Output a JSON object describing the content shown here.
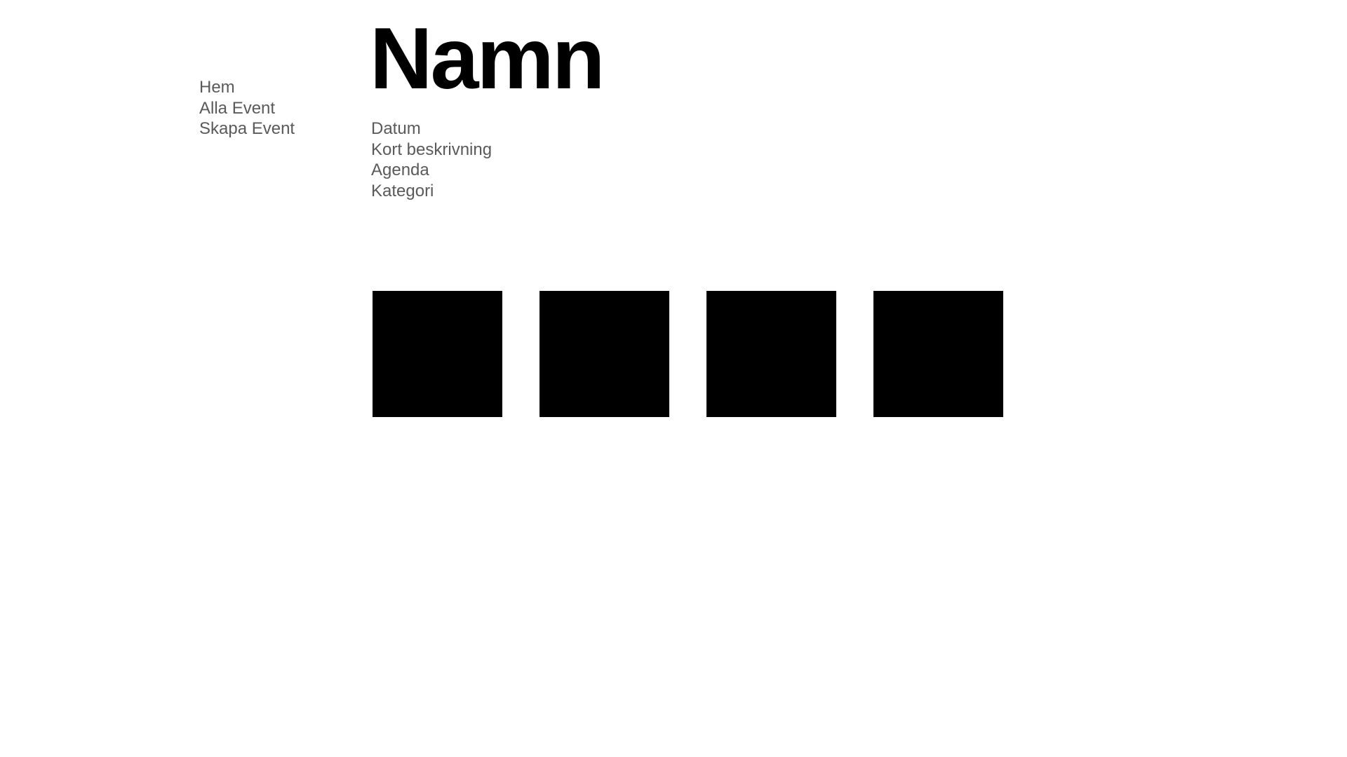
{
  "nav": {
    "items": [
      {
        "label": "Hem"
      },
      {
        "label": "Alla Event"
      },
      {
        "label": "Skapa Event"
      }
    ]
  },
  "event": {
    "title": "Namn",
    "fields": [
      {
        "label": "Datum"
      },
      {
        "label": "Kort beskrivning"
      },
      {
        "label": "Agenda"
      },
      {
        "label": "Kategori"
      }
    ]
  },
  "gallery": {
    "tile_color": "#000000",
    "tile_count": 4
  }
}
